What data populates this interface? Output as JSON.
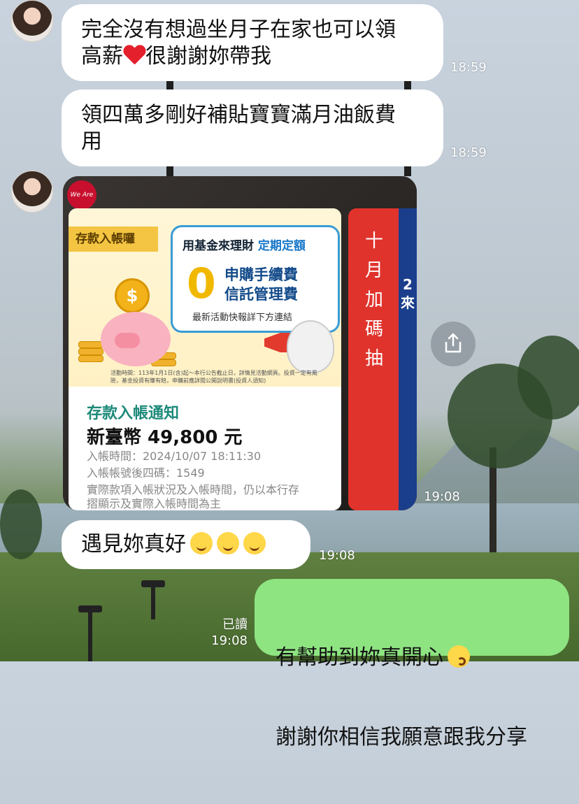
{
  "messages": [
    {
      "text": "完全沒有想過坐月子在家也可以領\n高薪",
      "tail": "很謝謝妳帶我",
      "time": "18:59"
    },
    {
      "text": "領四萬多剛好補貼寶寶滿月油飯費\n用",
      "time": "18:59"
    },
    {
      "time": "19:08"
    },
    {
      "text": "遇見妳真好",
      "time": "19:08"
    },
    {
      "line1": "有幫助到妳真開心",
      "line2": "謝謝你相信我願意跟我分享",
      "read": "已讀",
      "time": "19:08"
    }
  ],
  "image_card": {
    "bank_logo": "We Are Family",
    "tag": "存款入帳囉",
    "promo_prefix": "用基金來理財",
    "promo_highlight": "定期定額",
    "promo_zero": "0",
    "promo_fee1": "申購手續費",
    "promo_fee2": "信託管理費",
    "promo_note": "最新活動快報詳下方連結",
    "coin_symbol": "$",
    "fine_print": "活動時間：113年1月1日(含)起～本行公告截止日，詳情見活動網頁。投資一定有風險，基金投資有賺有賠，申購前應詳閱公開說明書(投資人須知)",
    "notice_title": "存款入帳通知",
    "notice_amount": "新臺幣 49,800 元",
    "notice_time": "入帳時間：2024/10/07 18:11:30",
    "notice_account": "入帳帳號後四碼：1549",
    "notice_note1": "實際款項入帳狀況及入帳時間，仍以本行存",
    "notice_note2": "摺顯示及實際入帳時間為主",
    "side_text": "十月加碼抽",
    "side_frag": "2\n來"
  },
  "colors": {
    "bubble_in": "#ffffff",
    "bubble_out": "#8ee481",
    "accent_red": "#e4202c"
  }
}
